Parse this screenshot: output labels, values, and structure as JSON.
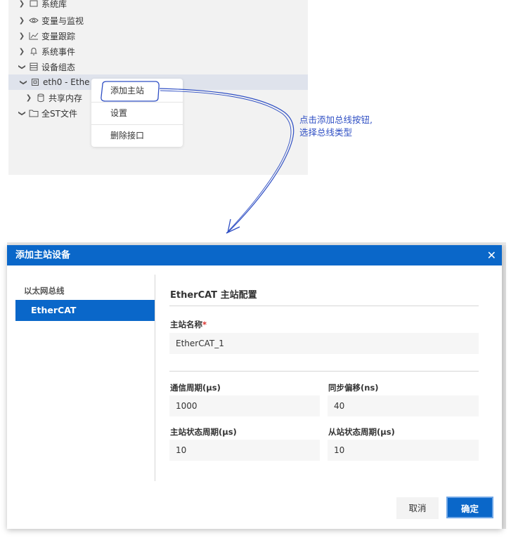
{
  "tree": {
    "items": [
      {
        "label": "系统库",
        "icon": "library-icon",
        "expanded": false
      },
      {
        "label": "变量与监视",
        "icon": "eye-icon",
        "expanded": false
      },
      {
        "label": "变量跟踪",
        "icon": "chart-line-icon",
        "expanded": false
      },
      {
        "label": "系统事件",
        "icon": "bell-icon",
        "expanded": false
      },
      {
        "label": "设备组态",
        "icon": "device-config-icon",
        "expanded": true
      },
      {
        "label": "eth0 - Ethe",
        "icon": "network-port-icon",
        "expanded": true
      },
      {
        "label": "共享内存",
        "icon": "cylinder-icon",
        "expanded": false
      },
      {
        "label": "全ST文件",
        "icon": "folder-icon",
        "expanded": true
      }
    ]
  },
  "context_menu": {
    "items": [
      "添加主站",
      "设置",
      "删除接口"
    ]
  },
  "annotation": {
    "line1": "点击添加总线按钮,",
    "line2": "选择总线类型"
  },
  "dialog": {
    "title": "添加主站设备",
    "nav_group": "以太网总线",
    "nav_selected": "EtherCAT",
    "section_title": "EtherCAT 主站配置",
    "fields": {
      "master_name_label": "主站名称",
      "master_name_required": "*",
      "master_name_value": "EtherCAT_1",
      "cycle_label": "通信周期(µs)",
      "cycle_value": "1000",
      "sync_offset_label": "同步偏移(ns)",
      "sync_offset_value": "40",
      "master_status_label": "主站状态周期(µs)",
      "master_status_value": "10",
      "slave_status_label": "从站状态周期(µs)",
      "slave_status_value": "10"
    },
    "buttons": {
      "cancel": "取消",
      "ok": "确定"
    }
  },
  "colors": {
    "accent": "#0a67c9",
    "annotation": "#2f4fc4",
    "required": "#d9302c"
  }
}
